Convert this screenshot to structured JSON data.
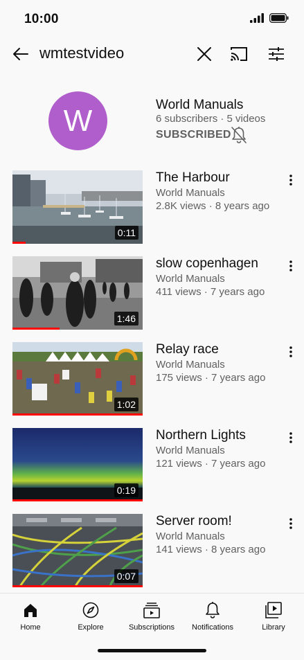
{
  "status": {
    "time": "10:00"
  },
  "search": {
    "query": "wmtestvideo"
  },
  "channel": {
    "initial": "W",
    "name": "World Manuals",
    "meta": "6 subscribers · 5 videos",
    "subscribed_label": "SUBSCRIBED",
    "avatar_color": "#b05ecb"
  },
  "videos": [
    {
      "title": "The Harbour",
      "channel": "World Manuals",
      "meta": "2.8K views · 8 years ago",
      "duration": "0:11",
      "watched_fraction": 0.1
    },
    {
      "title": "slow copenhagen",
      "channel": "World Manuals",
      "meta": "411 views · 7 years ago",
      "duration": "1:46",
      "watched_fraction": 0.36
    },
    {
      "title": "Relay race",
      "channel": "World Manuals",
      "meta": "175 views · 7 years ago",
      "duration": "1:02",
      "watched_fraction": 1.0
    },
    {
      "title": "Northern Lights",
      "channel": "World Manuals",
      "meta": "121 views · 7 years ago",
      "duration": "0:19",
      "watched_fraction": 1.0
    },
    {
      "title": "Server room!",
      "channel": "World Manuals",
      "meta": "141 views · 8 years ago",
      "duration": "0:07",
      "watched_fraction": 1.0
    }
  ],
  "nav": {
    "home": "Home",
    "explore": "Explore",
    "subscriptions": "Subscriptions",
    "notifications": "Notifications",
    "library": "Library"
  },
  "colors": {
    "progress": "#ff0000",
    "secondary_text": "#606060",
    "background": "#f9f9f9"
  }
}
